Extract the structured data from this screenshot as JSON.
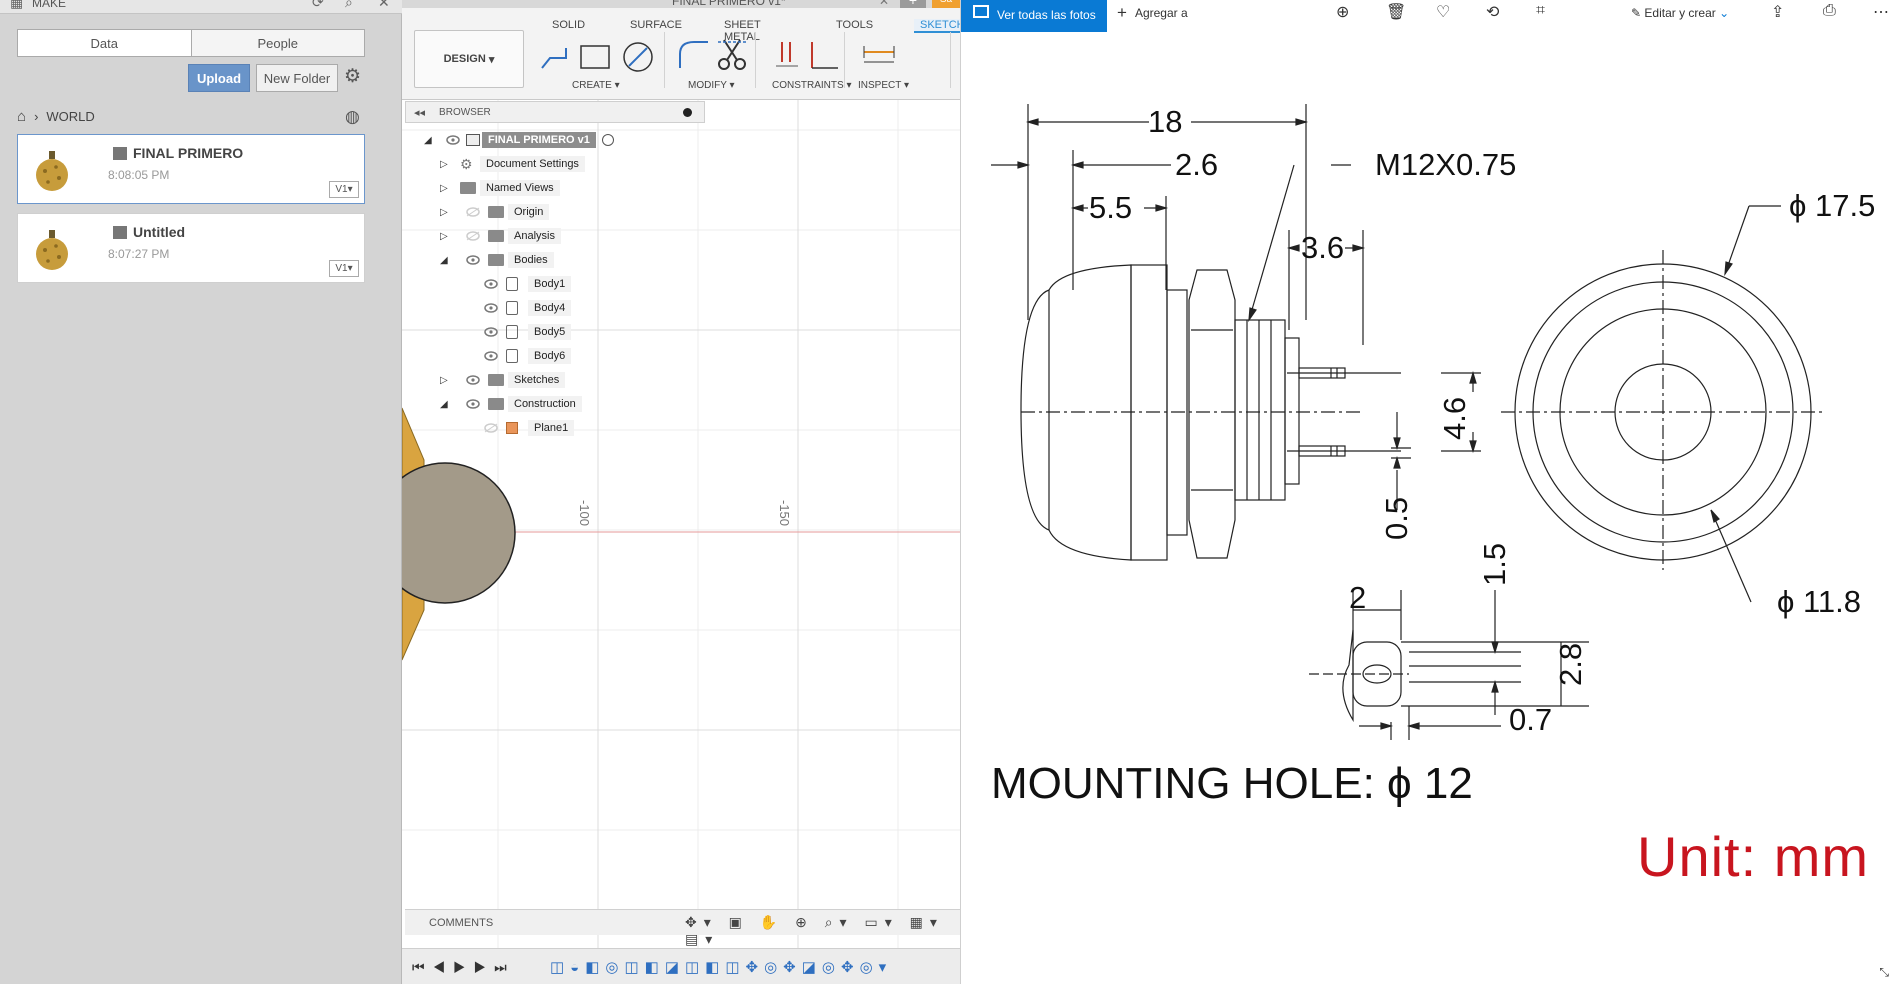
{
  "data_panel": {
    "title": "MAKE",
    "tabs": [
      "Data",
      "People"
    ],
    "upload_label": "Upload",
    "new_folder_label": "New Folder",
    "breadcrumb": "WORLD",
    "files": [
      {
        "name": "FINAL PRIMERO",
        "time": "8:08:05 PM",
        "version": "V1"
      },
      {
        "name": "Untitled",
        "time": "8:07:27 PM",
        "version": "V1"
      }
    ]
  },
  "fusion": {
    "document_tab": "FINAL PRIMERO v1*",
    "save_label": "Sa",
    "ribbon_tabs": [
      "SOLID",
      "SURFACE",
      "SHEET METAL",
      "TOOLS",
      "SKETCH"
    ],
    "workspace": "DESIGN",
    "groups": [
      "CREATE",
      "MODIFY",
      "CONSTRAINTS",
      "INSPECT"
    ],
    "browser_label": "BROWSER",
    "tree": [
      {
        "label": "FINAL PRIMERO v1",
        "level": 0
      },
      {
        "label": "Document Settings",
        "level": 1
      },
      {
        "label": "Named Views",
        "level": 1
      },
      {
        "label": "Origin",
        "level": 1
      },
      {
        "label": "Analysis",
        "level": 1
      },
      {
        "label": "Bodies",
        "level": 1
      },
      {
        "label": "Body1",
        "level": 2
      },
      {
        "label": "Body4",
        "level": 2
      },
      {
        "label": "Body5",
        "level": 2
      },
      {
        "label": "Body6",
        "level": 2
      },
      {
        "label": "Sketches",
        "level": 1
      },
      {
        "label": "Construction",
        "level": 1
      },
      {
        "label": "Plane1",
        "level": 2
      }
    ],
    "ruler_labels": [
      "-100",
      "-150"
    ],
    "comments_label": "COMMENTS"
  },
  "photos": {
    "view_all_label": "Ver todas las fotos",
    "add_label": "Agregar a",
    "edit_label": "Editar y crear",
    "drawing": {
      "dim_18": "18",
      "dim_2_6": "2.6",
      "dim_5_5": "5.5",
      "dim_3_6": "3.6",
      "thread": "M12X0.75",
      "dia_17_5": "ϕ 17.5",
      "dia_11_8": "ϕ 11.8",
      "dim_4_6": "4.6",
      "dim_0_5": "0.5",
      "dim_1_5": "1.5",
      "dim_2": "2",
      "dim_2_8": "2.8",
      "dim_0_7": "0.7",
      "mounting_hole": "MOUNTING HOLE:  ϕ 12"
    },
    "unit_label": "Unit: mm",
    "colors": {
      "unit_red": "#c8151f",
      "accent_blue": "#0a7ad4"
    }
  }
}
